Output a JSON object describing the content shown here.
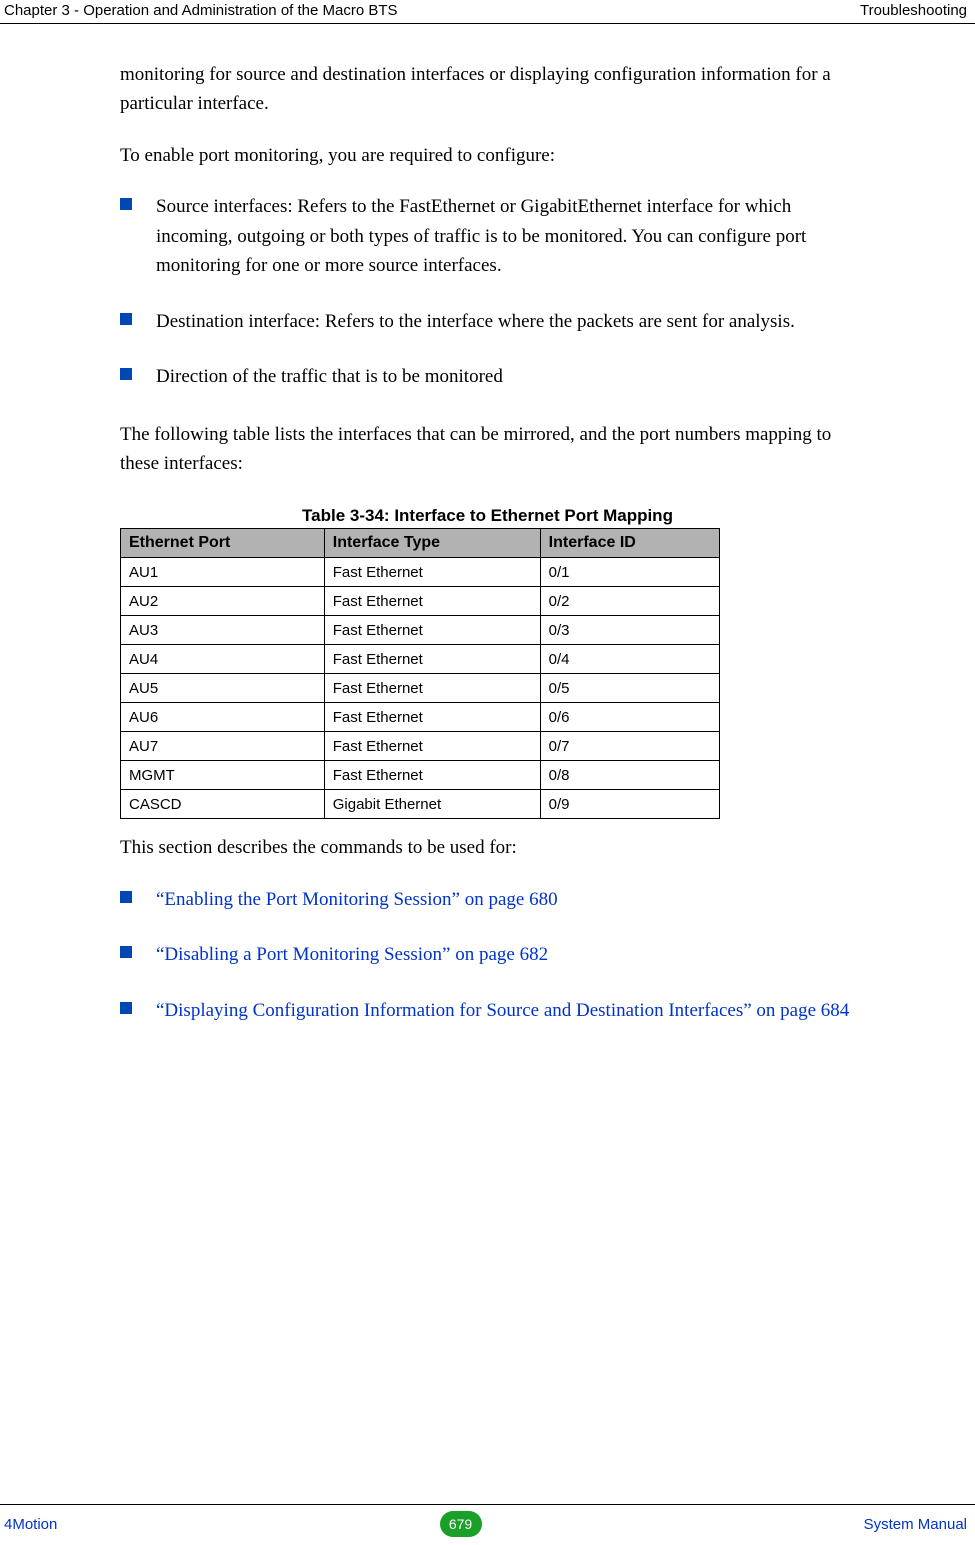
{
  "header": {
    "left": "Chapter 3 - Operation and Administration of the Macro BTS",
    "right": "Troubleshooting"
  },
  "footer": {
    "left": "4Motion",
    "page": "679",
    "right": "System Manual"
  },
  "body": {
    "para1": "monitoring for source and destination interfaces or displaying configuration information for a particular interface.",
    "para2": "To enable port monitoring, you are required to configure:",
    "config_list": [
      "Source interfaces: Refers to the FastEthernet or GigabitEthernet interface for which incoming, outgoing or both types of traffic is to be monitored. You can configure port monitoring for one or more source interfaces.",
      "Destination interface: Refers to the interface where the packets are sent for analysis.",
      "Direction of the traffic that is to be monitored"
    ],
    "para3": "The following table lists the interfaces that can be mirrored, and the port numbers mapping to these interfaces:",
    "para4": "This section describes the commands to be used for:",
    "link_list": [
      "“Enabling the Port Monitoring Session” on page 680",
      "“Disabling a Port Monitoring Session” on page 682",
      "“Displaying Configuration Information for Source and Destination Interfaces” on page 684"
    ]
  },
  "table": {
    "caption": "Table 3-34: Interface to Ethernet Port Mapping",
    "headers": [
      "Ethernet Port",
      "Interface Type",
      "Interface ID"
    ],
    "rows": [
      [
        "AU1",
        "Fast Ethernet",
        "0/1"
      ],
      [
        "AU2",
        "Fast Ethernet",
        "0/2"
      ],
      [
        "AU3",
        "Fast Ethernet",
        "0/3"
      ],
      [
        "AU4",
        "Fast Ethernet",
        "0/4"
      ],
      [
        "AU5",
        "Fast Ethernet",
        "0/5"
      ],
      [
        "AU6",
        "Fast Ethernet",
        "0/6"
      ],
      [
        "AU7",
        "Fast Ethernet",
        "0/7"
      ],
      [
        "MGMT",
        "Fast Ethernet",
        "0/8"
      ],
      [
        "CASCD",
        "Gigabit Ethernet",
        "0/9"
      ]
    ]
  }
}
